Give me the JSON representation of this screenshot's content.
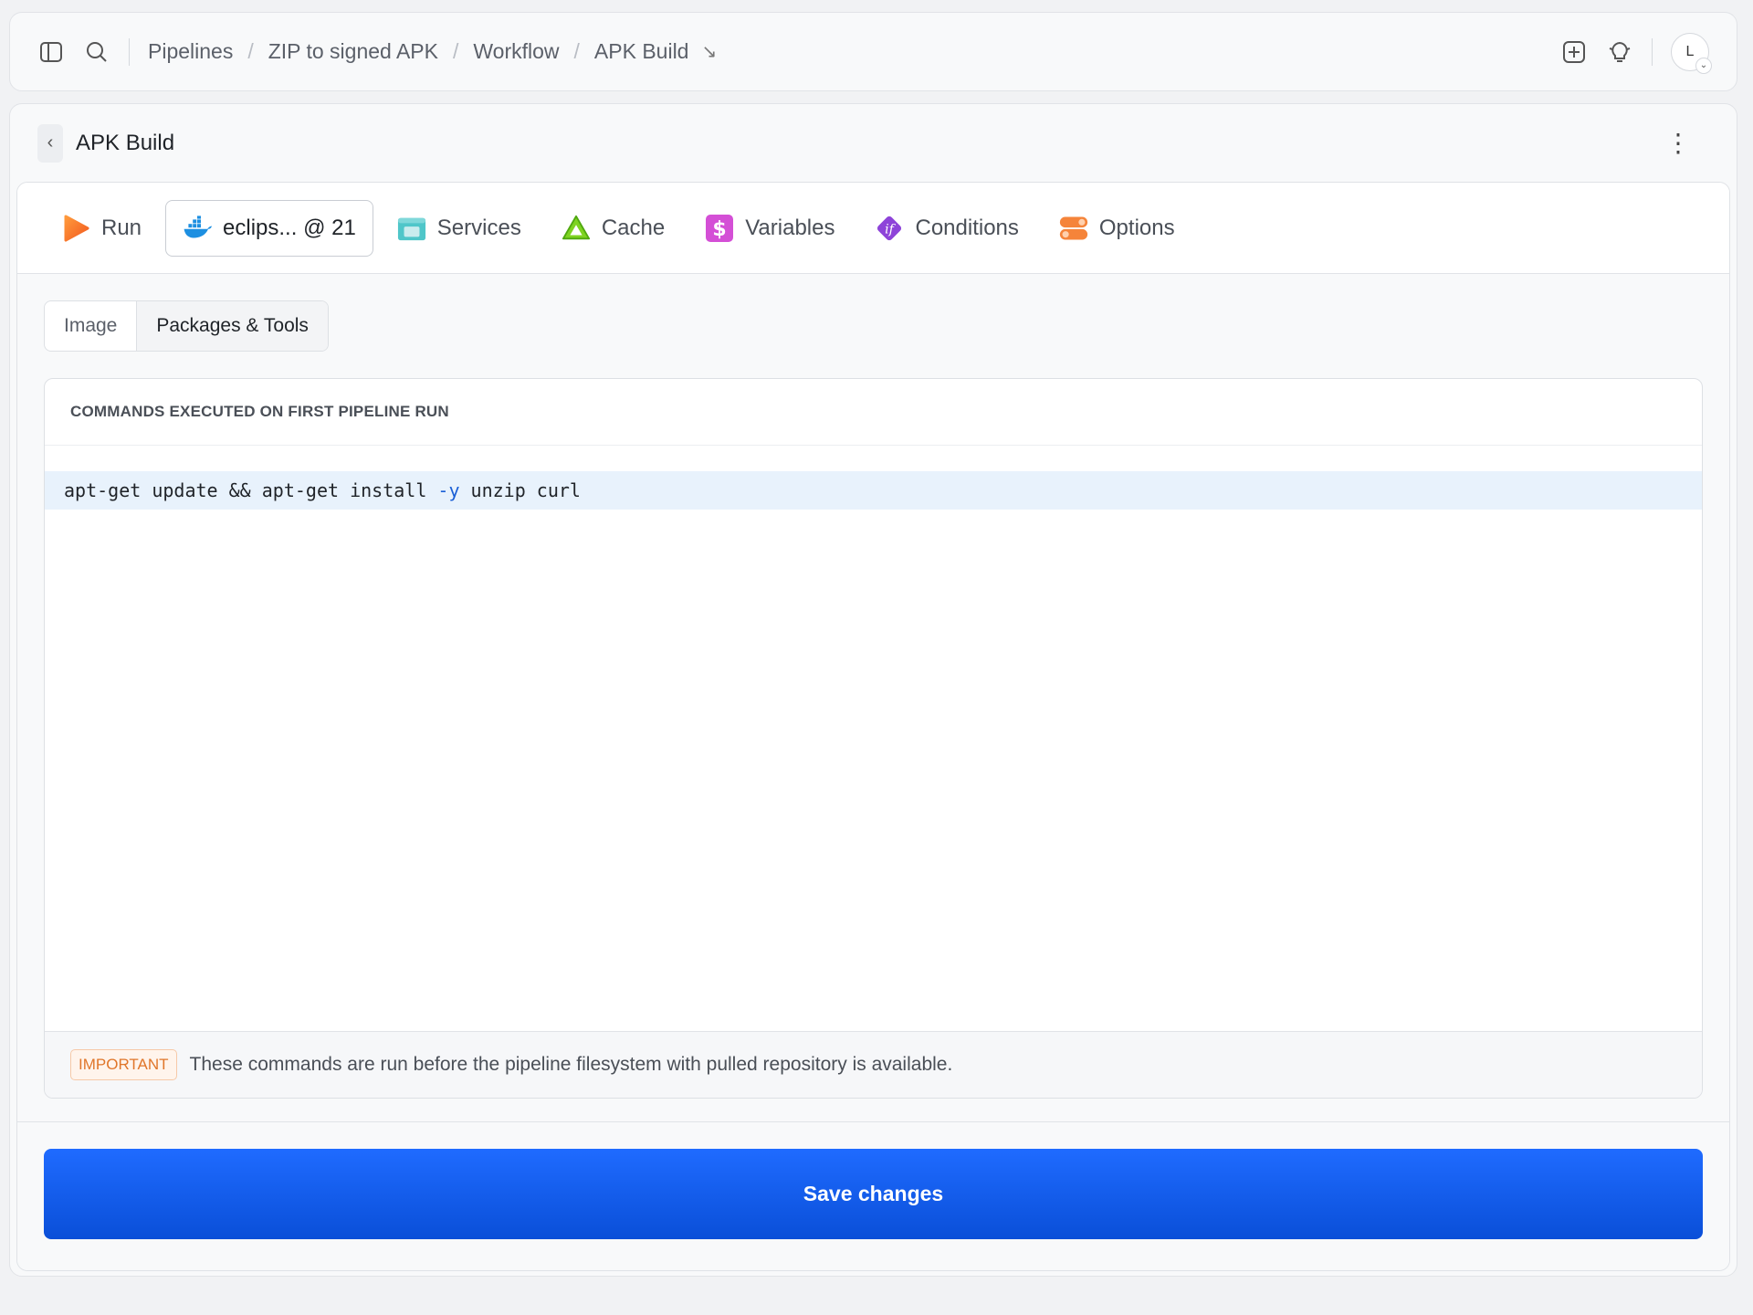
{
  "breadcrumbs": [
    "Pipelines",
    "ZIP to signed APK",
    "Workflow",
    "APK Build"
  ],
  "breadcrumb_arrow": "↘",
  "user_initial": "L",
  "panel": {
    "title": "APK Build"
  },
  "tabs": [
    {
      "label": "Run",
      "icon": "play-icon",
      "active": false
    },
    {
      "label": "eclips... @ 21",
      "icon": "docker-whale-icon",
      "active": true
    },
    {
      "label": "Services",
      "icon": "services-icon",
      "active": false
    },
    {
      "label": "Cache",
      "icon": "cache-triangle-icon",
      "active": false
    },
    {
      "label": "Variables",
      "icon": "dollar-icon",
      "active": false
    },
    {
      "label": "Conditions",
      "icon": "if-diamond-icon",
      "active": false
    },
    {
      "label": "Options",
      "icon": "toggles-icon",
      "active": false
    }
  ],
  "subtabs": [
    {
      "label": "Image",
      "active": false
    },
    {
      "label": "Packages & Tools",
      "active": true
    }
  ],
  "editor": {
    "heading": "COMMANDS EXECUTED ON FIRST PIPELINE RUN",
    "code_before": "apt-get update && apt-get install ",
    "code_flag": "-y",
    "code_after": " unzip curl"
  },
  "note": {
    "badge": "IMPORTANT",
    "text": "These commands are run before the pipeline filesystem with pulled repository is available."
  },
  "save_label": "Save changes",
  "colors": {
    "accent": "#1f6bff",
    "badge": "#e0762a"
  }
}
